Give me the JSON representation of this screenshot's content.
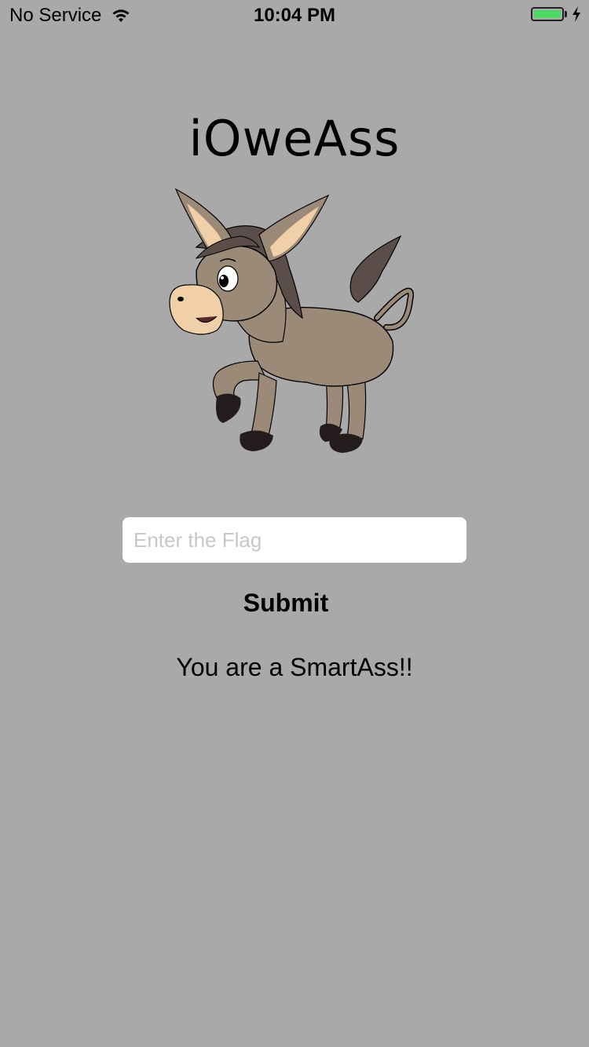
{
  "status_bar": {
    "carrier": "No Service",
    "time": "10:04 PM",
    "wifi_icon": "wifi-icon",
    "battery_icon": "battery-icon",
    "charging_icon": "bolt-icon",
    "battery_color": "#4cd964"
  },
  "app": {
    "title": "iOweAss",
    "image": "donkey-illustration"
  },
  "form": {
    "flag_value": "",
    "flag_placeholder": "Enter the Flag",
    "submit_label": "Submit"
  },
  "result": {
    "message": "You are a SmartAss!!"
  },
  "colors": {
    "background": "#a9a9a9",
    "input_background": "#ffffff",
    "placeholder": "#c7c7cd"
  }
}
